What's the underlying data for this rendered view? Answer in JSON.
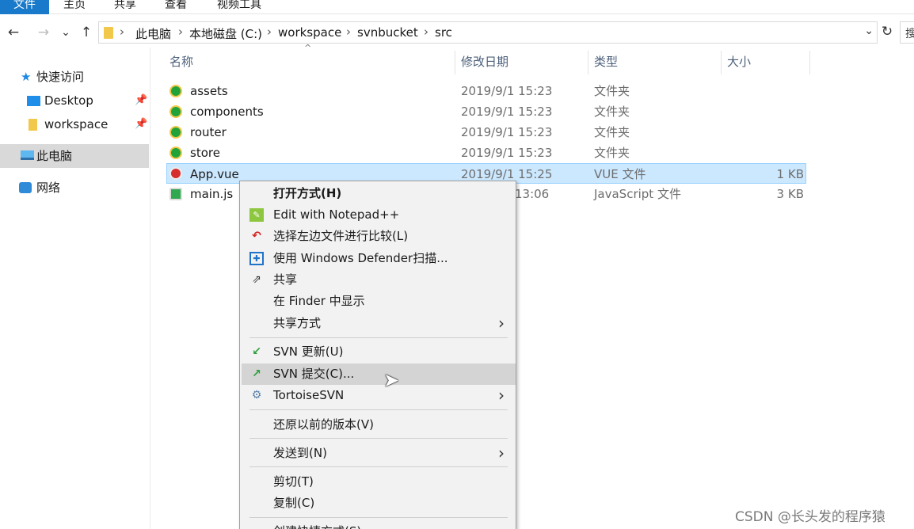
{
  "ribbon": {
    "tabs": [
      "文件",
      "主页",
      "共享",
      "查看",
      "视频工具"
    ]
  },
  "nav": {
    "back": "←",
    "forward": "→",
    "recent": "⌄",
    "up": "↑",
    "breadcrumb": [
      "此电脑",
      "本地磁盘 (C:)",
      "workspace",
      "svnbucket",
      "src"
    ],
    "separator": "›",
    "dropdown": "⌄",
    "refresh": "↻",
    "search": "搜"
  },
  "sidebar": {
    "items": [
      {
        "label": "快速访问",
        "icon": "star-icon"
      },
      {
        "label": "Desktop",
        "icon": "desktop-icon",
        "pin": "📌"
      },
      {
        "label": "workspace",
        "icon": "folder-icon",
        "pin": "📌"
      },
      {
        "label": "此电脑",
        "icon": "computer-icon",
        "selected": true
      },
      {
        "label": "网络",
        "icon": "network-icon"
      }
    ]
  },
  "columns": {
    "name": "名称",
    "date": "修改日期",
    "type": "类型",
    "size": "大小",
    "sort_indicator": "^"
  },
  "files": [
    {
      "name": "assets",
      "date": "2019/9/1 15:23",
      "type": "文件夹",
      "size": ""
    },
    {
      "name": "components",
      "date": "2019/9/1 15:23",
      "type": "文件夹",
      "size": ""
    },
    {
      "name": "router",
      "date": "2019/9/1 15:23",
      "type": "文件夹",
      "size": ""
    },
    {
      "name": "store",
      "date": "2019/9/1 15:23",
      "type": "文件夹",
      "size": ""
    },
    {
      "name": "App.vue",
      "date": "2019/9/1 15:25",
      "type": "VUE 文件",
      "size": "1 KB"
    },
    {
      "name": "main.js",
      "date": "13:06",
      "type": "JavaScript 文件",
      "size": "3 KB"
    }
  ],
  "context_menu": {
    "items": [
      {
        "label": "打开方式(H)",
        "bold": true
      },
      {
        "label": "Edit with Notepad++",
        "icon": "notepad-icon"
      },
      {
        "label": "选择左边文件进行比较(L)",
        "icon": "compare-icon"
      },
      {
        "label": "使用 Windows Defender扫描...",
        "icon": "defender-icon"
      },
      {
        "label": "共享",
        "icon": "share-icon"
      },
      {
        "label": "在 Finder 中显示"
      },
      {
        "label": "共享方式",
        "submenu": true
      },
      {
        "label": "SVN 更新(U)",
        "icon": "svn-update-icon"
      },
      {
        "label": "SVN 提交(C)...",
        "icon": "svn-commit-icon",
        "hover": true
      },
      {
        "label": "TortoiseSVN",
        "icon": "tortoisesvn-icon",
        "submenu": true
      },
      {
        "label": "还原以前的版本(V)"
      },
      {
        "label": "发送到(N)",
        "submenu": true
      },
      {
        "label": "剪切(T)"
      },
      {
        "label": "复制(C)"
      },
      {
        "label": "创建快捷方式(S)"
      }
    ],
    "submenu_arrow": "›"
  },
  "watermark": "CSDN @长头发的程序猿",
  "colors": {
    "file_tab": "#1979ca",
    "selection_bg": "#cce8ff",
    "selection_border": "#99d1ff",
    "menu_bg": "#f2f2f2",
    "menu_hover": "#d4d4d4",
    "sidebar_selected": "#d9d9d9"
  }
}
